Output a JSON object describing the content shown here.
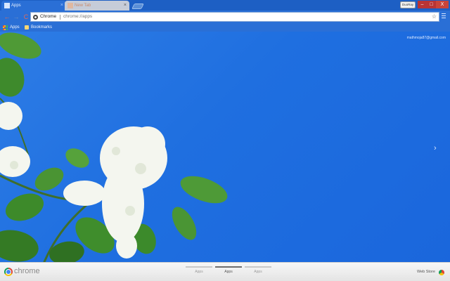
{
  "tabs": [
    {
      "label": "Apps",
      "active": true,
      "close": "×"
    },
    {
      "label": "New Tab",
      "active": false,
      "close": "×"
    }
  ],
  "window": {
    "profile_badge": "DuoRay",
    "minimize": "–",
    "maximize": "□",
    "close": "X"
  },
  "toolbar": {
    "back": "←",
    "forward": "→",
    "reload": "C",
    "omnibox_chip": "Chrome",
    "omnibox_url": "chrome://apps",
    "star": "☆"
  },
  "bookmarks": [
    {
      "label": "Apps"
    },
    {
      "label": "Bookmarks"
    }
  ],
  "page": {
    "user_email": "mathmoja87@gmail.com",
    "next_arrow": "›"
  },
  "bottom": {
    "wordmark": "chrome",
    "pages": [
      {
        "label": "Apps",
        "active": false
      },
      {
        "label": "Apps",
        "active": true
      },
      {
        "label": "Apps",
        "active": false
      }
    ],
    "webstore": "Web Store"
  },
  "colors": {
    "sky": "#1f6fe0",
    "chrome_frame": "#2a6fd6",
    "leaf": "#3a8a2a",
    "flower": "#f4f6ef"
  }
}
